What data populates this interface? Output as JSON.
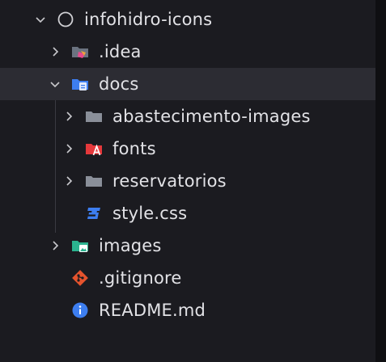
{
  "explorer": {
    "root": {
      "label": "infohidro-icons",
      "icon": "circle-icon",
      "expanded": true
    },
    "items": [
      {
        "label": ".idea",
        "icon": "idea-folder-icon",
        "expanded": false
      },
      {
        "label": "docs",
        "icon": "docs-folder-icon",
        "expanded": true
      },
      {
        "label": "abastecimento-images",
        "icon": "folder-icon",
        "expanded": false
      },
      {
        "label": "fonts",
        "icon": "fonts-folder-icon",
        "expanded": false
      },
      {
        "label": "reservatorios",
        "icon": "folder-icon",
        "expanded": false
      },
      {
        "label": "style.css",
        "icon": "css-file-icon"
      },
      {
        "label": "images",
        "icon": "images-folder-icon",
        "expanded": false
      },
      {
        "label": ".gitignore",
        "icon": "git-icon"
      },
      {
        "label": "README.md",
        "icon": "info-icon"
      }
    ]
  },
  "colors": {
    "background": "#1b1b20",
    "selected": "#2c2c33",
    "text": "#e2e2e6",
    "css_blue": "#3d7ef0",
    "git_red": "#e5532d",
    "info_blue": "#3d7ef0",
    "fonts_red": "#e5383b",
    "images_teal": "#2bb38f"
  }
}
